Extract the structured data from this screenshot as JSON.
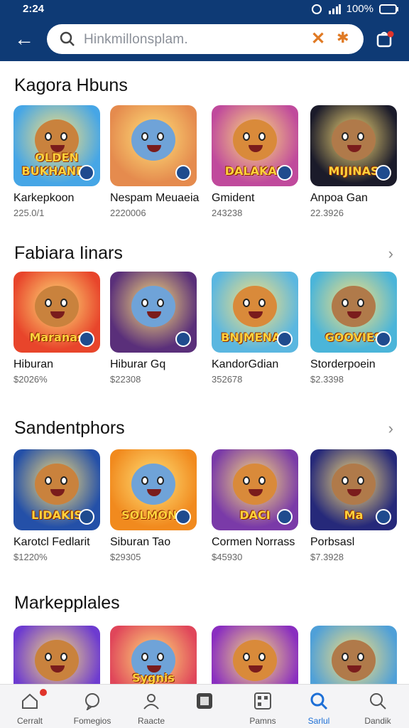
{
  "status": {
    "time": "2:24",
    "battery": "100%"
  },
  "search": {
    "placeholder": "Hinkmillonsplam."
  },
  "sections": [
    {
      "title": "Kagora Hbuns",
      "items": [
        {
          "name": "Karkepkoon",
          "price": "225.0/1",
          "banner": "OLDEN BUKHANES",
          "bg": "#46a6e6"
        },
        {
          "name": "Nespam Meuaeia",
          "price": "2220006",
          "banner": "",
          "bg": "#e58b4e"
        },
        {
          "name": "Gmident",
          "price": "243238",
          "banner": "DALAKAS",
          "bg": "#c04a9c"
        },
        {
          "name": "Anpoa Gan",
          "price": "22.3926",
          "banner": "MIJINAS",
          "bg": "#1b1b2a"
        }
      ]
    },
    {
      "title": "Fabiara Iinars",
      "items": [
        {
          "name": "Hiburan",
          "price": "$2026%",
          "banner": "Maranas",
          "bg": "#e8452b"
        },
        {
          "name": "Hiburar Gq",
          "price": "$22308",
          "banner": "",
          "bg": "#5a2f7a"
        },
        {
          "name": "KandorGdian",
          "price": "352678",
          "banner": "BNJMENAS",
          "bg": "#5bb7e0"
        },
        {
          "name": "Storderpoein",
          "price": "$2.3398",
          "banner": "GOOVIES",
          "bg": "#4bb5d9"
        }
      ]
    },
    {
      "title": "Sandentphors",
      "items": [
        {
          "name": "Karotcl Fedlarit",
          "price": "$1220%",
          "banner": "LIDAKIS",
          "bg": "#2450a8"
        },
        {
          "name": "Siburan Tao",
          "price": "$29305",
          "banner": "SOLMONS",
          "bg": "#f18a1e"
        },
        {
          "name": "Cormen Norrass",
          "price": "$45930",
          "banner": "DACI",
          "bg": "#7a3aa8"
        },
        {
          "name": "Porbsasl",
          "price": "$7.3928",
          "banner": "Ma",
          "bg": "#26297a"
        }
      ]
    },
    {
      "title": "Markepplales",
      "items": [
        {
          "name": "",
          "price": "",
          "banner": "",
          "bg": "#6d3bd0"
        },
        {
          "name": "",
          "price": "",
          "banner": "Sygnis Ponus",
          "bg": "#e0465a"
        },
        {
          "name": "",
          "price": "",
          "banner": "",
          "bg": "#8a2ec0"
        },
        {
          "name": "",
          "price": "",
          "banner": "",
          "bg": "#4fa0d8"
        }
      ]
    }
  ],
  "nav": [
    {
      "label": "Cerralt",
      "icon": "home-icon"
    },
    {
      "label": "Fomegios",
      "icon": "chat-icon"
    },
    {
      "label": "Raacte",
      "icon": "profile-icon"
    },
    {
      "label": "",
      "icon": "square-icon"
    },
    {
      "label": "Pamns",
      "icon": "grid-icon"
    },
    {
      "label": "Sarlul",
      "icon": "search-icon"
    },
    {
      "label": "Dandik",
      "icon": "search-outline-icon"
    }
  ],
  "colors": {
    "header": "#0e3a75",
    "active": "#1d6fd6",
    "accent": "#e07a24"
  }
}
